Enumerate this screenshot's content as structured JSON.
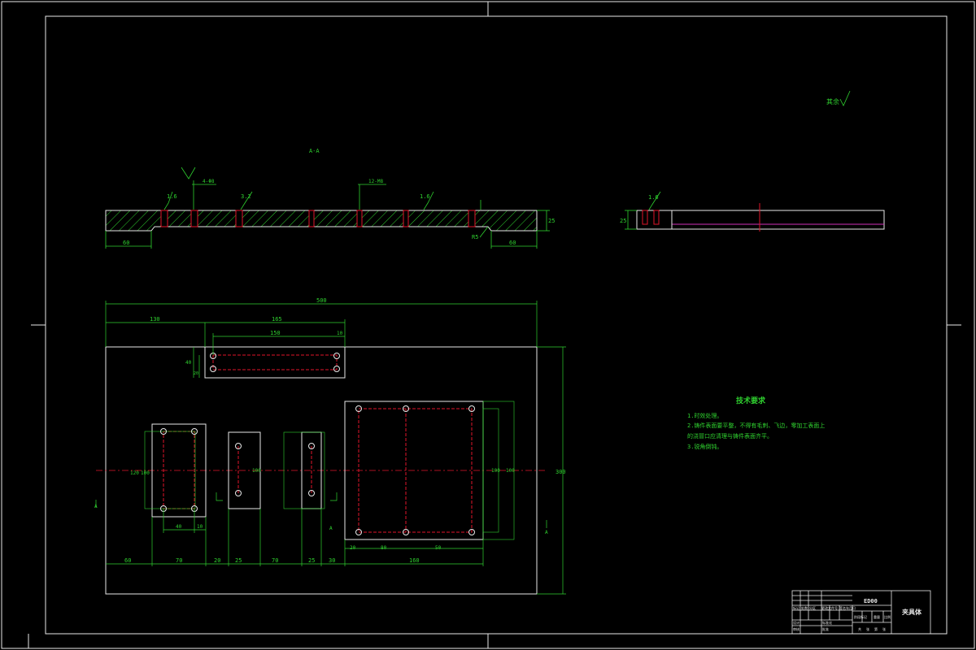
{
  "drawing": {
    "section_label": "A-A",
    "surface_note": "其余",
    "main_length": "500",
    "main_height": "300",
    "section_thickness": "25",
    "section_offsets": [
      "60",
      "60"
    ],
    "section_roughness": [
      "1.6",
      "3.2",
      "1.6",
      "1.6"
    ],
    "section_hole_callouts": [
      "4-Φ8",
      "12-M8"
    ],
    "section_fillet": "R5",
    "side_view_thickness": "25",
    "side_view_roughness": "1.6",
    "top_dims": [
      "130",
      "165",
      "150",
      "10"
    ],
    "small_plate_dims": [
      "40",
      "20",
      "10"
    ],
    "bottom_dims": [
      "60",
      "70",
      "20",
      "25",
      "70",
      "25",
      "30",
      "160"
    ],
    "left_block_dims": [
      "120",
      "100",
      "40",
      "10"
    ],
    "mid_block_dims": [
      "100"
    ],
    "right_block_dims": [
      "100",
      "20",
      "80",
      "50",
      "100",
      "150"
    ],
    "section_marks": [
      "A",
      "A",
      "A",
      "A"
    ]
  },
  "tech_requirements": {
    "title": "技术要求",
    "items": [
      "1.时效处理。",
      "2.铸件表面要平整，不得有毛刺、飞边，零加工表面上",
      "的浇冒口应清理与铸件表面齐平。",
      "3.锐角倒钝。"
    ]
  },
  "title_block": {
    "drawing_number": "ED00",
    "part_name": "夹具体",
    "row_labels": [
      "标记",
      "处数",
      "分区",
      "更改文件号",
      "签名",
      "年月日"
    ],
    "cols": [
      "阶段标记",
      "重量",
      "比例"
    ],
    "sub": [
      "设计",
      "标准化",
      "审核",
      "工艺",
      "批准"
    ],
    "sheet": [
      "共",
      "张",
      "第",
      "张"
    ]
  },
  "colors": {
    "outline": "#e8e8e8",
    "dimension": "#2fd12f",
    "centerline": "#e0152a",
    "hatch": "#2fd12f",
    "section_line": "#d12fb8"
  }
}
